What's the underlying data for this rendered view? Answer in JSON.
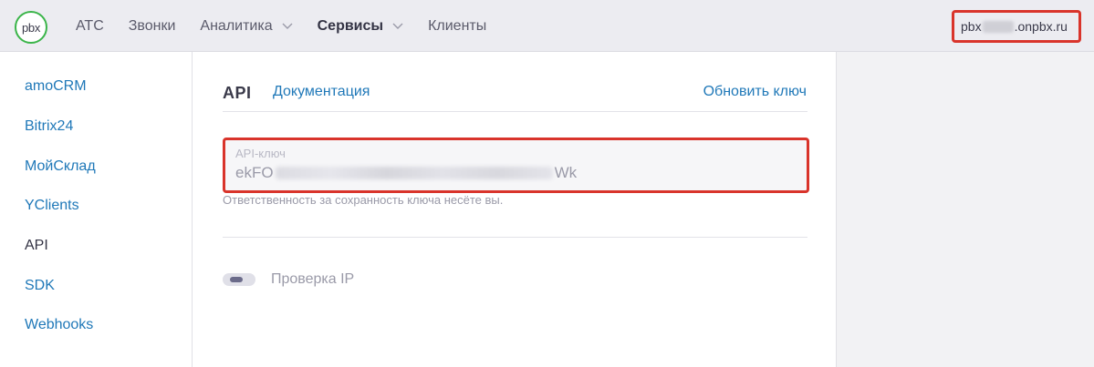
{
  "header": {
    "logo_text": "pbx",
    "nav": [
      {
        "label": "АТС",
        "has_dropdown": false,
        "active": false
      },
      {
        "label": "Звонки",
        "has_dropdown": false,
        "active": false
      },
      {
        "label": "Аналитика",
        "has_dropdown": true,
        "active": false
      },
      {
        "label": "Сервисы",
        "has_dropdown": true,
        "active": true
      },
      {
        "label": "Клиенты",
        "has_dropdown": false,
        "active": false
      }
    ],
    "domain_prefix": "pbx",
    "domain_suffix": ".onpbx.ru"
  },
  "sidebar": {
    "items": [
      {
        "label": "amoCRM",
        "active": false
      },
      {
        "label": "Bitrix24",
        "active": false
      },
      {
        "label": "МойСклад",
        "active": false
      },
      {
        "label": "YClients",
        "active": false
      },
      {
        "label": "API",
        "active": true
      },
      {
        "label": "SDK",
        "active": false
      },
      {
        "label": "Webhooks",
        "active": false
      }
    ]
  },
  "main": {
    "title": "API",
    "doc_link": "Документация",
    "refresh_link": "Обновить ключ",
    "api_key": {
      "label": "API-ключ",
      "value_prefix": "ekFO",
      "value_suffix": "Wk",
      "hint": "Ответственность за сохранность ключа несёте вы."
    },
    "ip_check": {
      "label": "Проверка IP",
      "enabled": false
    }
  },
  "colors": {
    "accent": "#1f78b8",
    "highlight": "#d9342b",
    "logo_ring": "#3bb54a"
  }
}
